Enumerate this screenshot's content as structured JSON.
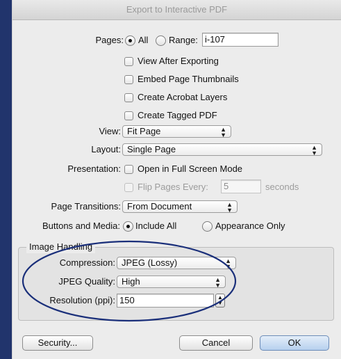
{
  "window": {
    "title": "Export to Interactive PDF"
  },
  "pages": {
    "label": "Pages:",
    "all_label": "All",
    "range_label": "Range:",
    "range_value": "i-107",
    "selected": "All"
  },
  "options": {
    "view_after_exporting": "View After Exporting",
    "embed_page_thumbnails": "Embed Page Thumbnails",
    "create_acrobat_layers": "Create Acrobat Layers",
    "create_tagged_pdf": "Create Tagged PDF"
  },
  "view": {
    "label": "View:",
    "value": "Fit Page"
  },
  "layout": {
    "label": "Layout:",
    "value": "Single Page"
  },
  "presentation": {
    "label": "Presentation:",
    "full_screen_label": "Open in Full Screen Mode",
    "flip_label": "Flip Pages Every:",
    "flip_value": "5",
    "seconds_label": "seconds"
  },
  "page_transitions": {
    "label": "Page Transitions:",
    "value": "From Document"
  },
  "buttons_media": {
    "label": "Buttons and Media:",
    "include_all_label": "Include All",
    "appearance_only_label": "Appearance Only",
    "selected": "Include All"
  },
  "image_handling": {
    "group_title": "Image Handling",
    "compression_label": "Compression:",
    "compression_value": "JPEG (Lossy)",
    "quality_label": "JPEG Quality:",
    "quality_value": "High",
    "resolution_label": "Resolution (ppi):",
    "resolution_value": "150"
  },
  "buttons": {
    "security": "Security...",
    "cancel": "Cancel",
    "ok": "OK"
  },
  "colors": {
    "background": "#21346c",
    "dialog": "#ececec",
    "annotation_ellipse": "#1a2f7a"
  }
}
